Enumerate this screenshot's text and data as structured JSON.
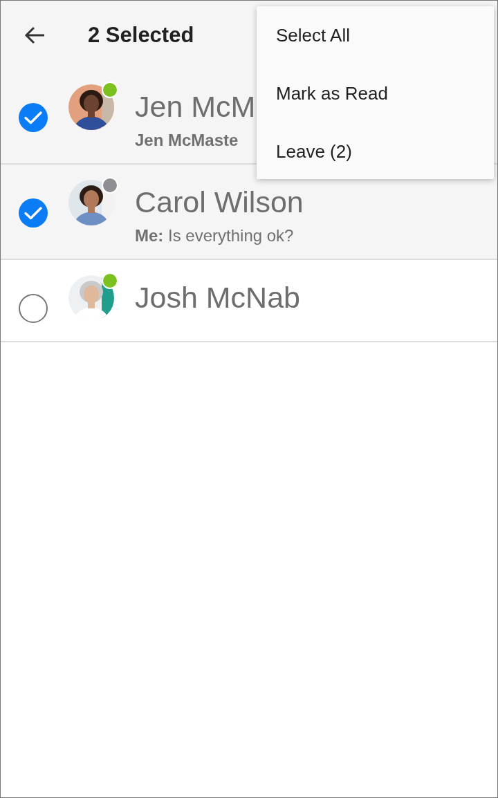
{
  "header": {
    "back_icon": true,
    "title": "2 Selected"
  },
  "conversations": [
    {
      "name": "Jen McM",
      "subtitle": "**Jen McMaste**",
      "selected": true,
      "status": {
        "color": "#7cc11f"
      }
    },
    {
      "name": "Carol Wilson",
      "subtitle": "**Me:** Is everything ok?",
      "selected": true,
      "status": {
        "color": "#8e8e93"
      }
    },
    {
      "name": "Josh McNab",
      "selected": false,
      "status": {
        "color": "#7cc11f"
      }
    }
  ],
  "menu": {
    "items": [
      {
        "label": "Select All"
      },
      {
        "label": "Mark as Read"
      },
      {
        "label": "Leave (2)"
      }
    ]
  }
}
